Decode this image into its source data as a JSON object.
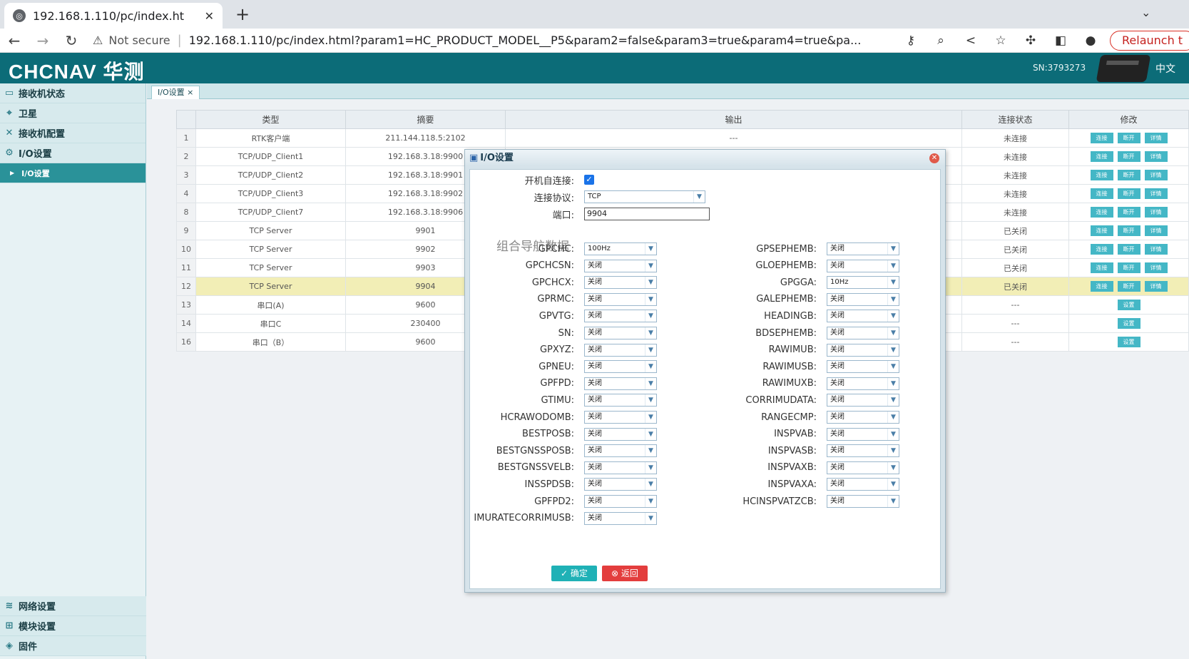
{
  "browser": {
    "tab_title": "192.168.1.110/pc/index.ht",
    "tab_close": "✕",
    "new_tab": "+",
    "security": "Not secure",
    "url": "192.168.1.110/pc/index.html?param1=HC_PRODUCT_MODEL__P5&param2=false&param3=true&param4=true&pa...",
    "relaunch": "Relaunch t"
  },
  "header": {
    "logo": "CHCNAV 华测",
    "sn": "SN:3793273",
    "lang": "中文"
  },
  "sidebar": {
    "items": [
      {
        "label": "接收机状态",
        "icon": "receiver-icon"
      },
      {
        "label": "卫星",
        "icon": "satellite-icon"
      },
      {
        "label": "接收机配置",
        "icon": "tools-icon"
      },
      {
        "label": "I/O设置",
        "icon": "gear-icon"
      }
    ],
    "sub_item": "I/O设置",
    "bottom_items": [
      {
        "label": "网络设置",
        "icon": "wifi-icon"
      },
      {
        "label": "模块设置",
        "icon": "module-icon"
      },
      {
        "label": "固件",
        "icon": "layers-icon"
      }
    ]
  },
  "page_tab": {
    "label": "I/O设置 ×"
  },
  "table": {
    "headers": [
      "",
      "类型",
      "摘要",
      "输出",
      "连接状态",
      "修改"
    ],
    "rows": [
      {
        "no": "1",
        "type": "RTK客户端",
        "summary": "211.144.118.5:2102",
        "output": "---",
        "status": "未连接",
        "actions": [
          "连接",
          "断开",
          "详情"
        ]
      },
      {
        "no": "2",
        "type": "TCP/UDP_Client1",
        "summary": "192.168.3.18:9900",
        "output": "",
        "status": "未连接",
        "actions": [
          "连接",
          "断开",
          "详情"
        ]
      },
      {
        "no": "3",
        "type": "TCP/UDP_Client2",
        "summary": "192.168.3.18:9901",
        "output": "",
        "status": "未连接",
        "actions": [
          "连接",
          "断开",
          "详情"
        ]
      },
      {
        "no": "4",
        "type": "TCP/UDP_Client3",
        "summary": "192.168.3.18:9902",
        "output": "",
        "status": "未连接",
        "actions": [
          "连接",
          "断开",
          "详情"
        ]
      },
      {
        "no": "8",
        "type": "TCP/UDP_Client7",
        "summary": "192.168.3.18:9906",
        "output": "",
        "status": "未连接",
        "actions": [
          "连接",
          "断开",
          "详情"
        ]
      },
      {
        "no": "9",
        "type": "TCP Server",
        "summary": "9901",
        "output": "",
        "status": "已关闭",
        "actions": [
          "连接",
          "断开",
          "详情"
        ]
      },
      {
        "no": "10",
        "type": "TCP Server",
        "summary": "9902",
        "output": "",
        "status": "已关闭",
        "actions": [
          "连接",
          "断开",
          "详情"
        ]
      },
      {
        "no": "11",
        "type": "TCP Server",
        "summary": "9903",
        "output": "",
        "status": "已关闭",
        "actions": [
          "连接",
          "断开",
          "详情"
        ]
      },
      {
        "no": "12",
        "type": "TCP Server",
        "summary": "9904",
        "output": "",
        "status": "已关闭",
        "actions": [
          "连接",
          "断开",
          "详情"
        ],
        "highlight": true
      },
      {
        "no": "13",
        "type": "串口(A)",
        "summary": "9600",
        "output": "",
        "status": "---",
        "actions": [
          "设置"
        ]
      },
      {
        "no": "14",
        "type": "串口C",
        "summary": "230400",
        "output": "",
        "status": "---",
        "actions": [
          "设置"
        ]
      },
      {
        "no": "16",
        "type": "串口（B）",
        "summary": "9600",
        "output": "",
        "status": "---",
        "actions": [
          "设置"
        ]
      }
    ]
  },
  "dialog": {
    "title": "I/O设置",
    "auto_connect_label": "开机自连接:",
    "auto_connect_checked": true,
    "protocol_label": "连接协议:",
    "protocol_value": "TCP",
    "port_label": "端口:",
    "port_value": "9904",
    "section_title": "组合导航数据",
    "left_fields": [
      {
        "label": "GPCHC:",
        "value": "100Hz"
      },
      {
        "label": "GPCHCSN:",
        "value": "关闭"
      },
      {
        "label": "GPCHCX:",
        "value": "关闭"
      },
      {
        "label": "GPRMC:",
        "value": "关闭"
      },
      {
        "label": "GPVTG:",
        "value": "关闭"
      },
      {
        "label": "SN:",
        "value": "关闭"
      },
      {
        "label": "GPXYZ:",
        "value": "关闭"
      },
      {
        "label": "GPNEU:",
        "value": "关闭"
      },
      {
        "label": "GPFPD:",
        "value": "关闭"
      },
      {
        "label": "GTIMU:",
        "value": "关闭"
      },
      {
        "label": "HCRAWODOMB:",
        "value": "关闭"
      },
      {
        "label": "BESTPOSB:",
        "value": "关闭"
      },
      {
        "label": "BESTGNSSPOSB:",
        "value": "关闭"
      },
      {
        "label": "BESTGNSSVELB:",
        "value": "关闭"
      },
      {
        "label": "INSSPDSB:",
        "value": "关闭"
      },
      {
        "label": "GPFPD2:",
        "value": "关闭"
      },
      {
        "label": "IMURATECORRIMUSB:",
        "value": "关闭"
      }
    ],
    "right_fields": [
      {
        "label": "GPSEPHEMB:",
        "value": "关闭"
      },
      {
        "label": "GLOEPHEMB:",
        "value": "关闭"
      },
      {
        "label": "GPGGA:",
        "value": "10Hz"
      },
      {
        "label": "GALEPHEMB:",
        "value": "关闭"
      },
      {
        "label": "HEADINGB:",
        "value": "关闭"
      },
      {
        "label": "BDSEPHEMB:",
        "value": "关闭"
      },
      {
        "label": "RAWIMUB:",
        "value": "关闭"
      },
      {
        "label": "RAWIMUSB:",
        "value": "关闭"
      },
      {
        "label": "RAWIMUXB:",
        "value": "关闭"
      },
      {
        "label": "CORRIMUDATA:",
        "value": "关闭"
      },
      {
        "label": "RANGECMP:",
        "value": "关闭"
      },
      {
        "label": "INSPVAB:",
        "value": "关闭"
      },
      {
        "label": "INSPVASB:",
        "value": "关闭"
      },
      {
        "label": "INSPVAXB:",
        "value": "关闭"
      },
      {
        "label": "INSPVAXA:",
        "value": "关闭"
      },
      {
        "label": "HCINSPVATZCB:",
        "value": "关闭"
      }
    ],
    "ok_label": "确定",
    "back_label": "返回"
  }
}
